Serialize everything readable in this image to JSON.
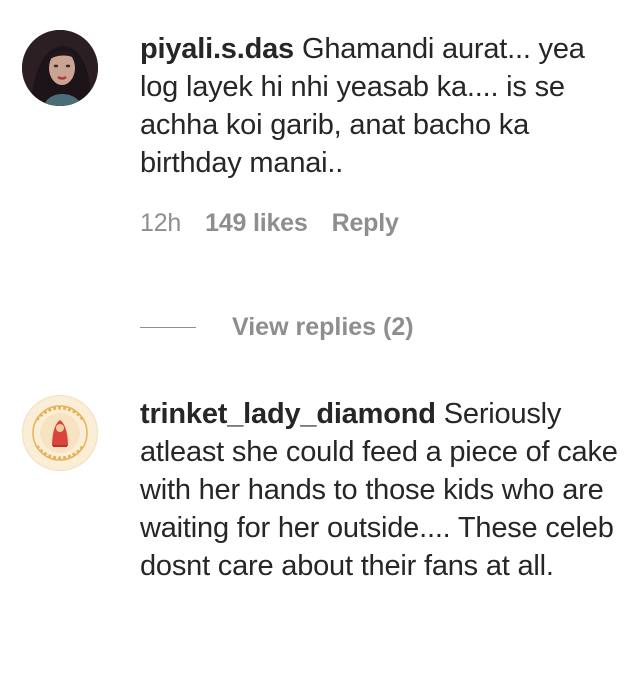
{
  "comments": [
    {
      "username": "piyali.s.das",
      "text": "Ghamandi aurat... yea log layek hi nhi yeasab ka.... is se achha koi garib, anat bacho ka birthday manai..",
      "time": "12h",
      "likes": "149 likes",
      "reply_label": "Reply",
      "avatar_icon": "profile-photo-woman"
    },
    {
      "username": "trinket_lady_diamond",
      "text": "Seriously atleast she could feed a piece of cake with her hands to those kids who are waiting for her outside.... These celeb dosnt care about their fans at all.",
      "avatar_icon": "trinket-lady-logo"
    }
  ],
  "view_replies_label": "View replies (2)",
  "colors": {
    "text": "#262626",
    "secondary": "#8e8e8e",
    "logo_red": "#d9453a",
    "logo_gold": "#e6b25c"
  }
}
